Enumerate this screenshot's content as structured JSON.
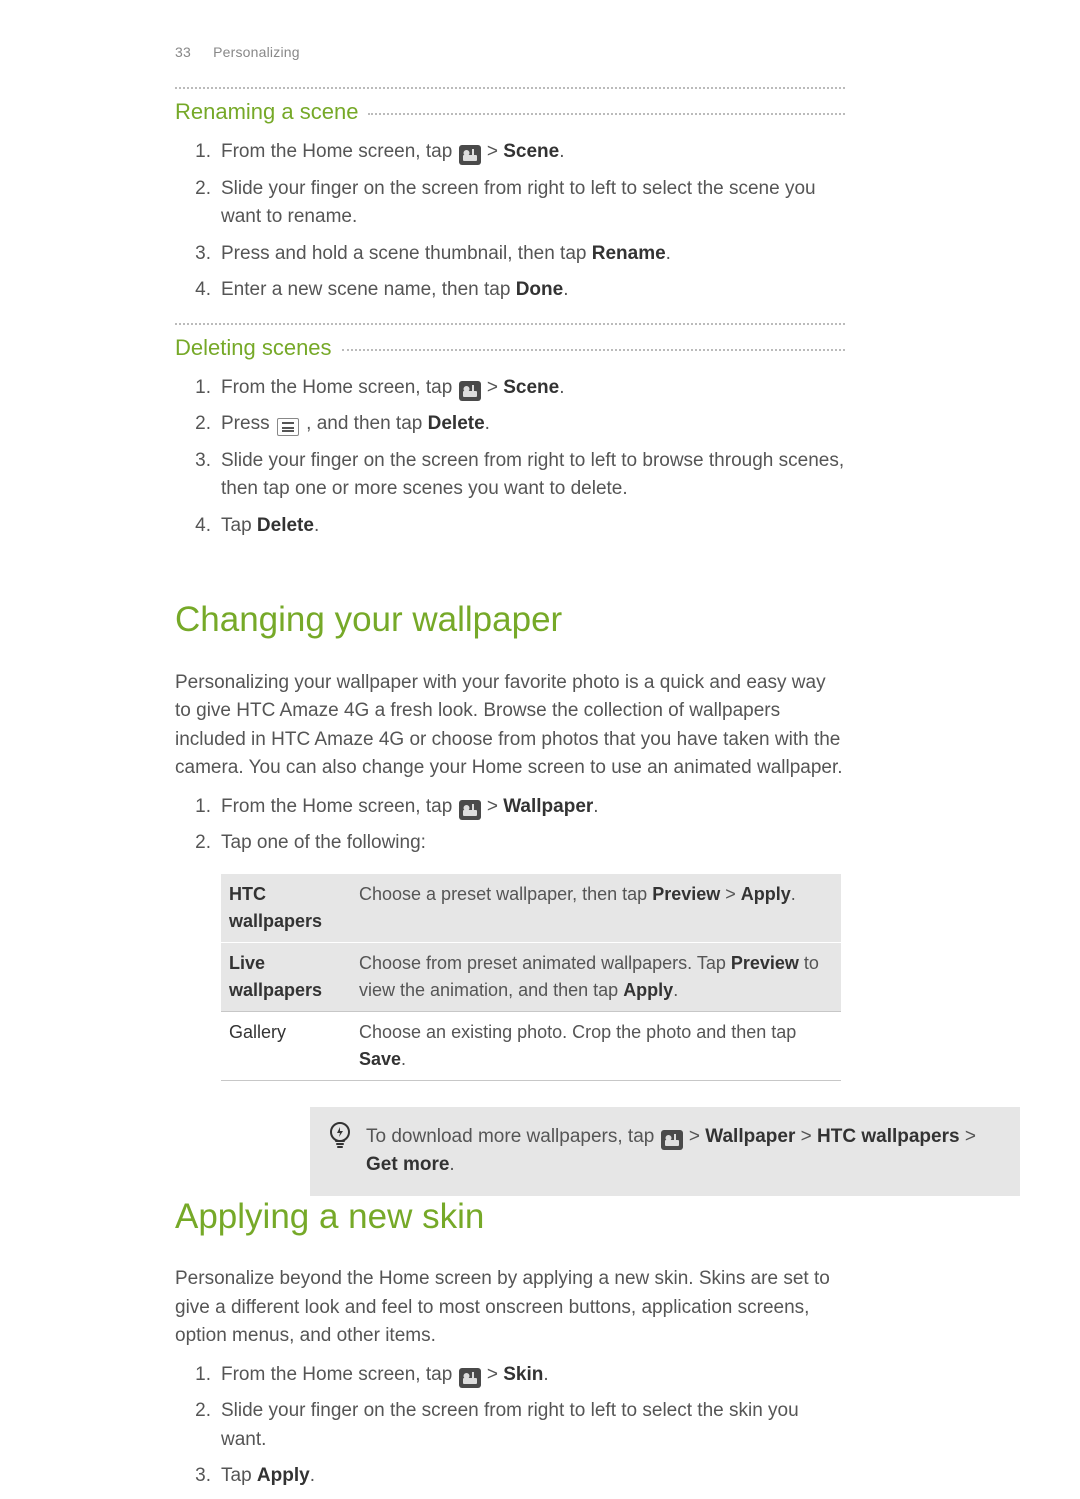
{
  "header": {
    "page_num": "33",
    "section": "Personalizing"
  },
  "rename": {
    "title": "Renaming a scene",
    "s1a": "From the Home screen, tap ",
    "s1b": " > ",
    "s1c": "Scene",
    "s1d": ".",
    "s2": "Slide your finger on the screen from right to left to select the scene you want to rename.",
    "s3a": "Press and hold a scene thumbnail, then tap ",
    "s3b": "Rename",
    "s3c": ".",
    "s4a": "Enter a new scene name, then tap ",
    "s4b": "Done",
    "s4c": "."
  },
  "delete": {
    "title": "Deleting scenes",
    "s1a": "From the Home screen, tap ",
    "s1b": " > ",
    "s1c": "Scene",
    "s1d": ".",
    "s2a": "Press ",
    "s2b": " , and then tap ",
    "s2c": "Delete",
    "s2d": ".",
    "s3": "Slide your finger on the screen from right to left to browse through scenes, then tap one or more scenes you want to delete.",
    "s4a": "Tap ",
    "s4b": "Delete",
    "s4c": "."
  },
  "wall": {
    "title": "Changing your wallpaper",
    "intro": "Personalizing your wallpaper with your favorite photo is a quick and easy way to give HTC Amaze 4G a fresh look. Browse the collection of wallpapers included in HTC Amaze 4G or choose from photos that you have taken with the camera. You can also change your Home screen to use an animated wallpaper.",
    "s1a": "From the Home screen, tap ",
    "s1b": " > ",
    "s1c": "Wallpaper",
    "s1d": ".",
    "s2": "Tap one of the following:",
    "row1": {
      "name": "HTC wallpapers",
      "a": "Choose a preset wallpaper, then tap ",
      "b": "Preview",
      "c": " > ",
      "d": "Apply",
      "e": "."
    },
    "row2": {
      "name": "Live wallpapers",
      "a": "Choose from preset animated wallpapers. Tap ",
      "b": "Preview",
      "c": " to view the animation, and then tap ",
      "d": "Apply",
      "e": "."
    },
    "row3": {
      "name": "Gallery",
      "a": "Choose an existing photo. Crop the photo and then tap ",
      "b": "Save",
      "c": "."
    },
    "tip": {
      "a": "To download more wallpapers, tap ",
      "b": " > ",
      "c": "Wallpaper",
      "d": " > ",
      "e": "HTC wallpapers",
      "f": " > ",
      "g": "Get more",
      "h": "."
    }
  },
  "skin": {
    "title": "Applying a new skin",
    "intro": "Personalize beyond the Home screen by applying a new skin. Skins are set to give a different look and feel to most onscreen buttons, application screens, option menus, and other items.",
    "s1a": "From the Home screen, tap ",
    "s1b": " > ",
    "s1c": "Skin",
    "s1d": ".",
    "s2": "Slide your finger on the screen from right to left to select the skin you want.",
    "s3a": "Tap ",
    "s3b": "Apply",
    "s3c": "."
  }
}
